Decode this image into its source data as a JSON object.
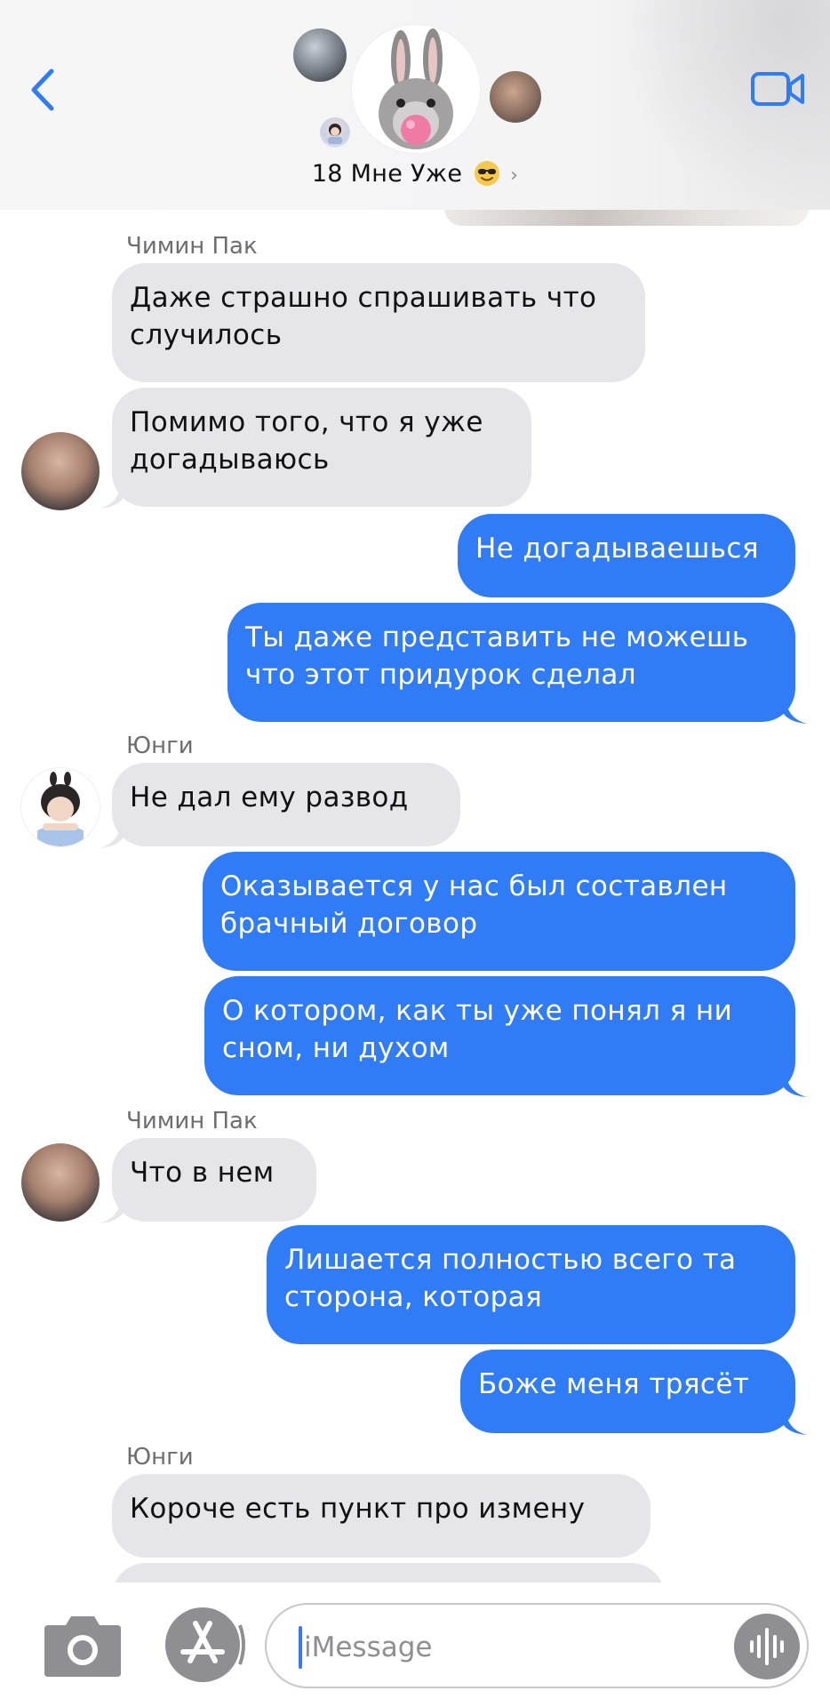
{
  "header": {
    "group_name": "18 Мне Уже",
    "title_emoji": "smiling-face-with-sunglasses",
    "back_icon": "chevron-left-icon",
    "video_icon": "video-camera-icon",
    "accent": "#2f7cf6"
  },
  "messages": [
    {
      "sender": "Чимин Пак",
      "direction": "in",
      "text": "Даже страшно спрашивать что\nслучилось"
    },
    {
      "direction": "in",
      "text": "Помимо того, что я уже\nдогадываюсь"
    },
    {
      "direction": "out",
      "text": "Не догадываешься"
    },
    {
      "direction": "out",
      "text": "Ты даже представить не можешь\nчто этот придурок сделал"
    },
    {
      "sender": "Юнги",
      "direction": "in",
      "text": "Не дал ему развод"
    },
    {
      "direction": "out",
      "text": "Оказывается у нас был составлен\nбрачный договор"
    },
    {
      "direction": "out",
      "text": "О котором,  как ты уже понял я ни\nсном, ни  духом"
    },
    {
      "sender": "Чимин Пак",
      "direction": "in",
      "text": "Что в нем"
    },
    {
      "direction": "out",
      "text": "Лишается полностью всего  та\nсторона,  которая"
    },
    {
      "direction": "out",
      "text": "Боже меня трясёт"
    },
    {
      "sender": "Юнги",
      "direction": "in",
      "text": "Короче есть пункт про измену"
    }
  ],
  "input": {
    "placeholder": "iMessage",
    "camera_icon": "camera-icon",
    "apps_icon": "app-store-icon",
    "mic_icon": "audio-waveform-icon"
  },
  "colors": {
    "incoming_bubble": "#e5e5ea",
    "outgoing_bubble": "#2f7cf6",
    "sender_label": "#6d6d72"
  }
}
